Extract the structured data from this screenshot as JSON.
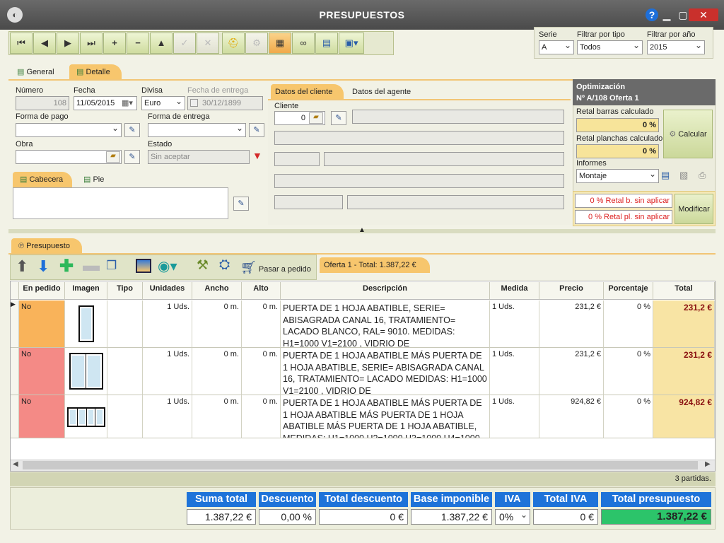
{
  "window": {
    "title": "PRESUPUESTOS",
    "help": "?",
    "minimize": "▁",
    "maximize": "▢",
    "close": "✕"
  },
  "toolbar": {
    "first": "⏮",
    "prev": "◀",
    "next": "▶",
    "last": "⏭",
    "add": "+",
    "remove": "−",
    "up": "▲",
    "confirm": "✓",
    "cancel": "✕"
  },
  "filters": {
    "serie_label": "Serie",
    "serie_value": "A",
    "tipo_label": "Filtrar por tipo",
    "tipo_value": "Todos",
    "anio_label": "Filtrar por año",
    "anio_value": "2015"
  },
  "tabs": {
    "general": "General",
    "detalle": "Detalle"
  },
  "form": {
    "numero_label": "Número",
    "numero_value": "108",
    "fecha_label": "Fecha",
    "fecha_value": "11/05/2015",
    "divisa_label": "Divisa",
    "divisa_value": "Euro",
    "fecha_entrega_label": "Fecha de entrega",
    "fecha_entrega_value": "30/12/1899",
    "forma_pago_label": "Forma de pago",
    "forma_pago_value": "",
    "forma_entrega_label": "Forma de entrega",
    "forma_entrega_value": "",
    "obra_label": "Obra",
    "obra_value": "",
    "estado_label": "Estado",
    "estado_value": "Sin aceptar"
  },
  "subtabs": {
    "cabecera": "Cabecera",
    "pie": "Pie"
  },
  "client": {
    "tab_cliente": "Datos del cliente",
    "tab_agente": "Datos del agente",
    "cliente_label": "Cliente",
    "cliente_value": "0"
  },
  "optimization": {
    "title": "Optimización",
    "subtitle": "Nº A/108 Oferta 1",
    "retal_barras_label": "Retal barras calculado",
    "retal_barras_value": "0 %",
    "retal_planchas_label": "Retal planchas calculado",
    "retal_planchas_value": "0 %",
    "calcular": "Calcular",
    "informes_label": "Informes",
    "informes_value": "Montaje",
    "retal_b_sin": "0 % Retal b. sin aplicar",
    "retal_pl_sin": "0 % Retal pl. sin aplicar",
    "modificar": "Modificar"
  },
  "presupuesto": {
    "tab": "Presupuesto",
    "pasar_pedido": "Pasar a pedido",
    "oferta_tab": "Oferta 1 - Total: 1.387,22 €"
  },
  "grid": {
    "headers": [
      "En pedido",
      "Imagen",
      "Tipo",
      "Unidades",
      "Ancho",
      "Alto",
      "Descripción",
      "Medida",
      "Precio",
      "Porcentaje",
      "Total"
    ],
    "rows": [
      {
        "en_pedido": "No",
        "unidades": "1 Uds.",
        "ancho": "0 m.",
        "alto": "0 m.",
        "descripcion": "PUERTA DE 1 HOJA ABATIBLE, SERIE= ABISAGRADA CANAL 16,  TRATAMIENTO= LACADO BLANCO, RAL= 9010. MEDIDAS: H1=1000 V1=2100  , VIDRIO DE",
        "medida": "1 Uds.",
        "precio": "231,2 €",
        "porcentaje": "0 %",
        "total": "231,2 €"
      },
      {
        "en_pedido": "No",
        "unidades": "1 Uds.",
        "ancho": "0 m.",
        "alto": "0 m.",
        "descripcion": "PUERTA DE 1 HOJA ABATIBLE MÁS PUERTA DE 1 HOJA ABATIBLE, SERIE= ABISAGRADA CANAL 16,  TRATAMIENTO=  LACADO MEDIDAS: H1=1000 V1=2100  , VIDRIO DE",
        "medida": "1 Uds.",
        "precio": "231,2 €",
        "porcentaje": "0 %",
        "total": "231,2 €"
      },
      {
        "en_pedido": "No",
        "unidades": "1 Uds.",
        "ancho": "0 m.",
        "alto": "0 m.",
        "descripcion": "PUERTA DE 1 HOJA ABATIBLE MÁS PUERTA DE 1 HOJA ABATIBLE MÁS PUERTA DE 1 HOJA ABATIBLE MÁS PUERTA DE 1 HOJA ABATIBLE, MEDIDAS: H1=1000 H2=1000 H3=1000 H4=1000",
        "medida": "1 Uds.",
        "precio": "924,82 €",
        "porcentaje": "0 %",
        "total": "924,82 €"
      }
    ],
    "partidas": "3 partidas."
  },
  "totals": {
    "suma_total_label": "Suma total",
    "suma_total": "1.387,22 €",
    "descuento_label": "Descuento",
    "descuento": "0,00 %",
    "total_descuento_label": "Total descuento",
    "total_descuento": "0 €",
    "base_imponible_label": "Base imponible",
    "base_imponible": "1.387,22 €",
    "iva_label": "IVA",
    "iva": "0%",
    "total_iva_label": "Total IVA",
    "total_iva": "0 €",
    "total_presupuesto_label": "Total presupuesto",
    "total_presupuesto": "1.387,22 €"
  }
}
